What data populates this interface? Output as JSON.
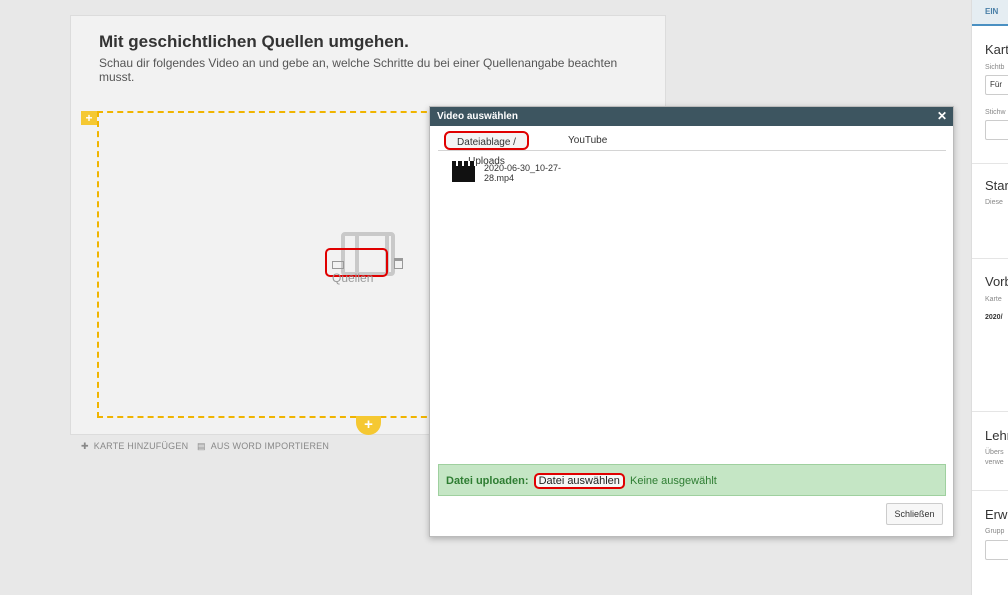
{
  "editor": {
    "title": "Mit geschichtlichen Quellen umgehen.",
    "description": "Schau dir folgendes Video an und gebe an, welche Schritte du bei einer Quellenangabe beachten musst.",
    "source_button": "Quellen",
    "add_card": "KARTE HINZUFÜGEN",
    "import_word": "AUS WORD IMPORTIEREN"
  },
  "modal": {
    "title": "Video auswählen",
    "tabs": [
      "Dateiablage / Uploads",
      "YouTube"
    ],
    "file_name": "2020-06-30_10-27-28.mp4",
    "upload_label": "Datei uploaden:",
    "choose_file": "Datei auswählen",
    "no_file": "Keine ausgewählt",
    "close_label": "Schließen"
  },
  "right_panel": {
    "tab": "EIN",
    "sections": [
      "Kart",
      "Star",
      "Vorb",
      "Lehr",
      "Erw"
    ],
    "small": [
      "Sichtb",
      "Stichw",
      "Diese",
      "Karte",
      "2020/",
      "Übers",
      "verwe",
      "Grupp"
    ],
    "input_value": "Für"
  }
}
